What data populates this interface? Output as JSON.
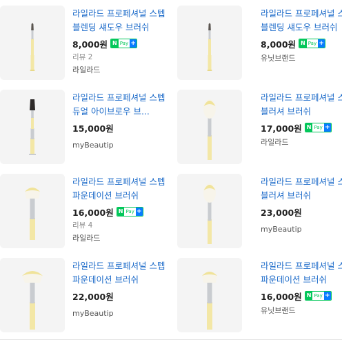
{
  "products": [
    {
      "title": "라일라드 프로페셔널 스텝 블렌딩 섀도우 브러쉬",
      "price": "8,000원",
      "npay": true,
      "review": "리뷰 2",
      "seller": "라일라드",
      "brush": "blending-shadow-brush"
    },
    {
      "title": "라일라드 프로페셔널 스텝 블렌딩 섀도우 브러쉬",
      "price": "8,000원",
      "npay": true,
      "review": "",
      "seller": "유닛브랜드",
      "brush": "blending-shadow-brush"
    },
    {
      "title": "라일라드 프로페셔널 스텝 듀얼 아이브로우 브...",
      "price": "15,000원",
      "npay": false,
      "review": "",
      "seller": "myBeautip",
      "brush": "dual-eyebrow-brush"
    },
    {
      "title": "라일라드 프로페셔널 스텝 블러셔 브러쉬",
      "price": "17,000원",
      "npay": true,
      "review": "",
      "seller": "라일라드",
      "brush": "blusher-brush"
    },
    {
      "title": "라일라드 프로페셔널 스텝 파운데이션 브러쉬",
      "price": "16,000원",
      "npay": true,
      "review": "리뷰 4",
      "seller": "라일라드",
      "brush": "foundation-brush"
    },
    {
      "title": "라일라드 프로페셔널 스텝 블러셔 브러쉬",
      "price": "23,000원",
      "npay": false,
      "review": "",
      "seller": "myBeautip",
      "brush": "blusher-brush"
    },
    {
      "title": "라일라드 프로페셔널 스텝 파운데이션 브러쉬",
      "price": "22,000원",
      "npay": false,
      "review": "",
      "seller": "myBeautip",
      "brush": "foundation-brush"
    },
    {
      "title": "라일라드 프로페셔널 스텝 파운데이션 브러쉬",
      "price": "16,000원",
      "npay": true,
      "review": "",
      "seller": "유닛브랜드",
      "brush": "foundation-brush"
    }
  ],
  "npay_badge": {
    "n": "N",
    "pay": "Pay",
    "plus": "+"
  },
  "colors": {
    "title": "#1b6ac9",
    "npay_green": "#03c75a",
    "npay_blue": "#0a7cff",
    "handle": "#f3e7a6",
    "ferrule": "#c9ccd0",
    "bristle_tip": "#f0e39a"
  }
}
